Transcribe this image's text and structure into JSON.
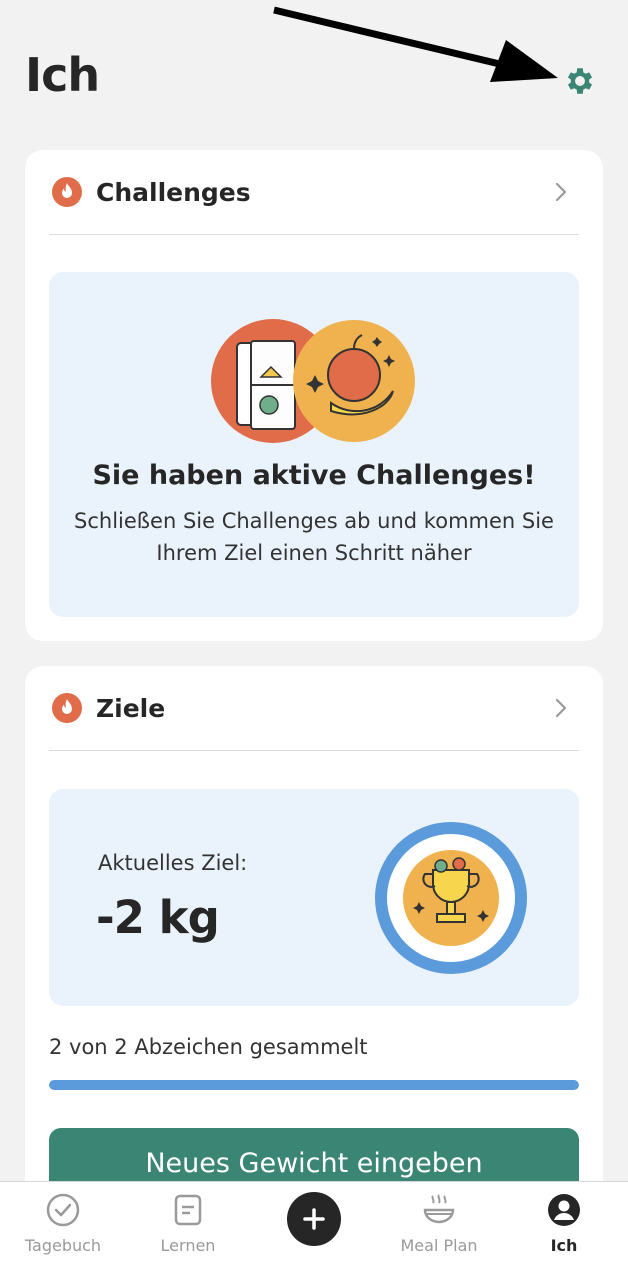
{
  "header": {
    "title": "Ich"
  },
  "challenges_card": {
    "title": "Challenges",
    "heading": "Sie haben aktive Challenges!",
    "text": "Schließen Sie Challenges ab und kommen Sie Ihrem Ziel einen Schritt näher"
  },
  "goals_card": {
    "title": "Ziele",
    "current_goal_label": "Aktuelles Ziel:",
    "current_goal_value": "-2 kg",
    "badges_text": "2 von 2 Abzeichen gesammelt",
    "badges_progress": 1.0,
    "cta_label": "Neues Gewicht eingeben"
  },
  "tabs": [
    {
      "label": "Tagebuch",
      "icon": "check-circle-icon"
    },
    {
      "label": "Lernen",
      "icon": "document-icon"
    },
    {
      "label": "",
      "icon": "plus-icon"
    },
    {
      "label": "Meal Plan",
      "icon": "bowl-icon"
    },
    {
      "label": "Ich",
      "icon": "profile-icon"
    }
  ],
  "colors": {
    "accent_green": "#3a8574",
    "flame_orange": "#e06c4a",
    "progress_blue": "#5b9bdc",
    "panel_blue": "#eaf3fc"
  }
}
